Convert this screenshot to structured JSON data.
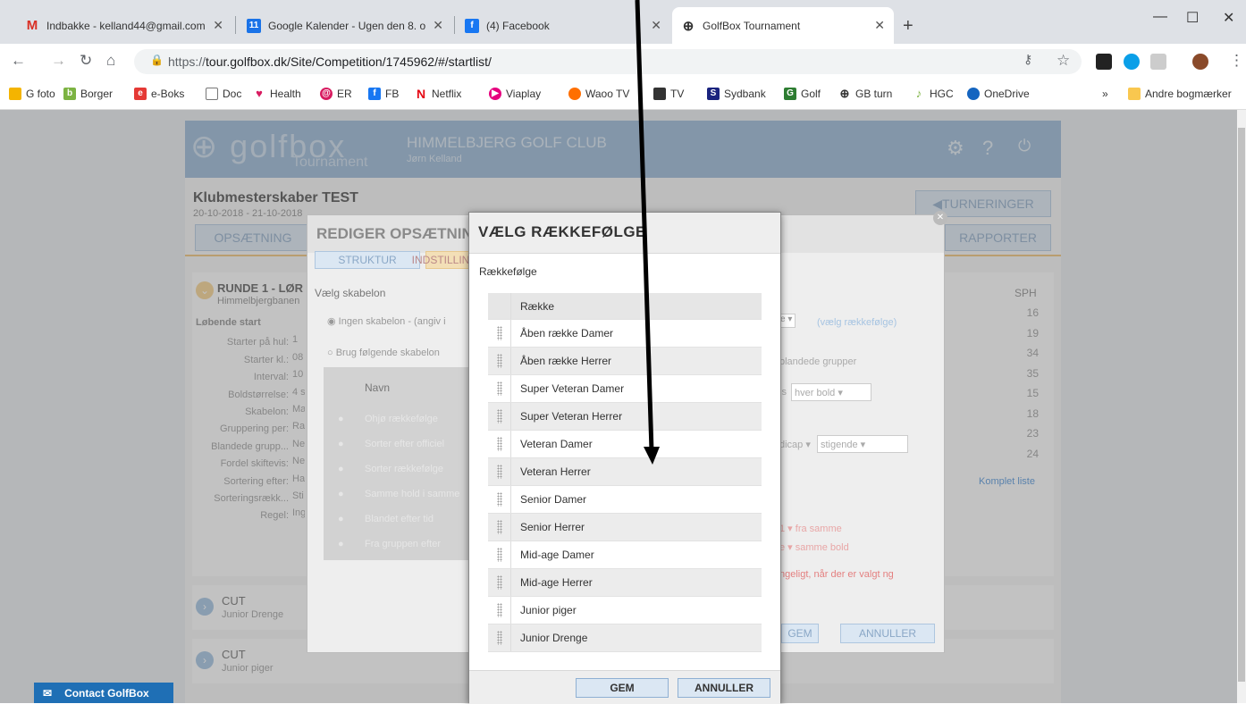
{
  "browser": {
    "tabs": [
      {
        "label": "Indbakke - kelland44@gmail.com",
        "icon": "gmail-icon",
        "color": "#d93025",
        "glyph": "M"
      },
      {
        "label": "Google Kalender - Ugen den 8. o",
        "icon": "calendar-icon",
        "color": "#1a73e8",
        "glyph": "11"
      },
      {
        "label": "(4) Facebook",
        "icon": "facebook-icon",
        "color": "#1877f2",
        "glyph": "f"
      },
      {
        "label": "GolfBox Tournament",
        "icon": "golfbox-icon",
        "color": "#555555",
        "glyph": "⊕"
      }
    ],
    "url_prefix": "https://",
    "url": "tour.golfbox.dk/Site/Competition/1745962/#/startlist/",
    "bookmarks": [
      "G foto",
      "Borger",
      "e-Boks",
      "Doc",
      "Health",
      "ER",
      "FB",
      "Netflix",
      "Viaplay",
      "Waoo TV",
      "TV",
      "Sydbank",
      "Golf",
      "GB turn",
      "HGC",
      "OneDrive"
    ],
    "other_bookmarks": "Andre bogmærker"
  },
  "app": {
    "logo": "golfbox",
    "logo_sub": "Tournament",
    "club": "HIMMELBJERG GOLF CLUB",
    "user": "Jørn Kelland",
    "competition_title": "Klubmesterskaber TEST",
    "competition_dates": "20-10-2018 - 21-10-2018",
    "turneringer_button": "TURNERINGER",
    "opsaetning_tab": "OPSÆTNING",
    "rapporter_tab": "RAPPORTER",
    "round": "RUNDE 1 - LØR",
    "round_course": "Himmelbjergbanen",
    "sph_header": "SPH",
    "sph_values": [
      "16",
      "19",
      "34",
      "35",
      "15",
      "18",
      "23",
      "24"
    ],
    "komplet_liste": "Komplet liste",
    "left_labels": [
      {
        "k": "Løbende start",
        "v": ""
      },
      {
        "k": "Starter på hul:",
        "v": "1"
      },
      {
        "k": "Starter kl.:",
        "v": "08"
      },
      {
        "k": "Interval:",
        "v": "10"
      },
      {
        "k": "Boldstørrelse:",
        "v": "4 s"
      },
      {
        "k": "Skabelon:",
        "v": "Ma"
      },
      {
        "k": "Gruppering per:",
        "v": "Ra"
      },
      {
        "k": "Blandede grupp...",
        "v": "Ne"
      },
      {
        "k": "Fordel skiftevis:",
        "v": "Ne"
      },
      {
        "k": "Sortering efter:",
        "v": "Ha"
      },
      {
        "k": "Sorteringsrækk...",
        "v": "Sti"
      },
      {
        "k": "Regel:",
        "v": "Ing"
      }
    ],
    "cut1_title": "CUT",
    "cut1_sub": "Junior Drenge",
    "cut2_title": "CUT",
    "cut2_sub": "Junior piger",
    "contact": "Contact GolfBox"
  },
  "edit_dialog": {
    "title": "REDIGER OPSÆTNING",
    "tab_struktur": "STRUKTUR",
    "tab_indstillinger": "INDSTILLINGER",
    "section": "Vælg skabelon",
    "option_none": "Ingen skabelon - (angiv i",
    "option_use": "Brug følgende skabelon",
    "col_navn": "Navn",
    "row_texts": [
      "Ohjø rækkefølge",
      "Sorter efter officiel",
      "Sorter rækkefølge",
      "Samme hold i samme",
      "Blandet efter tid",
      "Fra gruppen efter"
    ],
    "select_label": "e",
    "vaelg_link": "(vælg rækkefølge)",
    "blandede": "blandede grupper",
    "hver_bold_prefix": "is",
    "hver_bold": "hver bold",
    "handicap": "dicap",
    "stigende": "stigende",
    "fra_samme_val": "1",
    "fra_samme": "fra samme",
    "samme_bold_val": "e",
    "samme_bold": "samme bold",
    "warning": "ngeligt, når der er valgt ng",
    "gem": "GEM",
    "annuller": "ANNULLER"
  },
  "order_dialog": {
    "title": "VÆLG RÆKKEFØLGE",
    "subtitle": "Rækkefølge",
    "column": "Række",
    "rows": [
      "Åben række Damer",
      "Åben række Herrer",
      "Super Veteran Damer",
      "Super Veteran Herrer",
      "Veteran Damer",
      "Veteran Herrer",
      "Senior Damer",
      "Senior Herrer",
      "Mid-age Damer",
      "Mid-age Herrer",
      "Junior piger",
      "Junior Drenge"
    ],
    "gem": "GEM",
    "annuller": "ANNULLER"
  }
}
